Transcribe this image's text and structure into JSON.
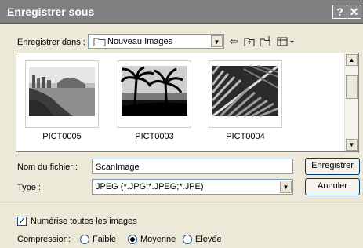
{
  "window": {
    "title": "Enregistrer sous",
    "help_glyph": "?",
    "close_glyph": "✕"
  },
  "save_in": {
    "label": "Enregistrer dans :",
    "value": "Nouveau Images"
  },
  "toolbar_icons": [
    "back-icon",
    "up-folder-icon",
    "new-folder-icon",
    "view-menu-icon"
  ],
  "files": [
    {
      "name": "PICT0005"
    },
    {
      "name": "PICT0003"
    },
    {
      "name": "PICT0004"
    }
  ],
  "filename": {
    "label": "Nom du fichier :",
    "value": "ScanImage"
  },
  "filetype": {
    "label": "Type :",
    "value": "JPEG (*.JPG;*.JPEG;*.JPE)"
  },
  "buttons": {
    "save": "Enregistrer",
    "cancel": "Annuler"
  },
  "scan_all": {
    "label": "Numérise toutes les images",
    "checked": true
  },
  "compression": {
    "label": "Compression:",
    "options": [
      "Faible",
      "Moyenne",
      "Elevée"
    ],
    "selected": "Moyenne"
  }
}
